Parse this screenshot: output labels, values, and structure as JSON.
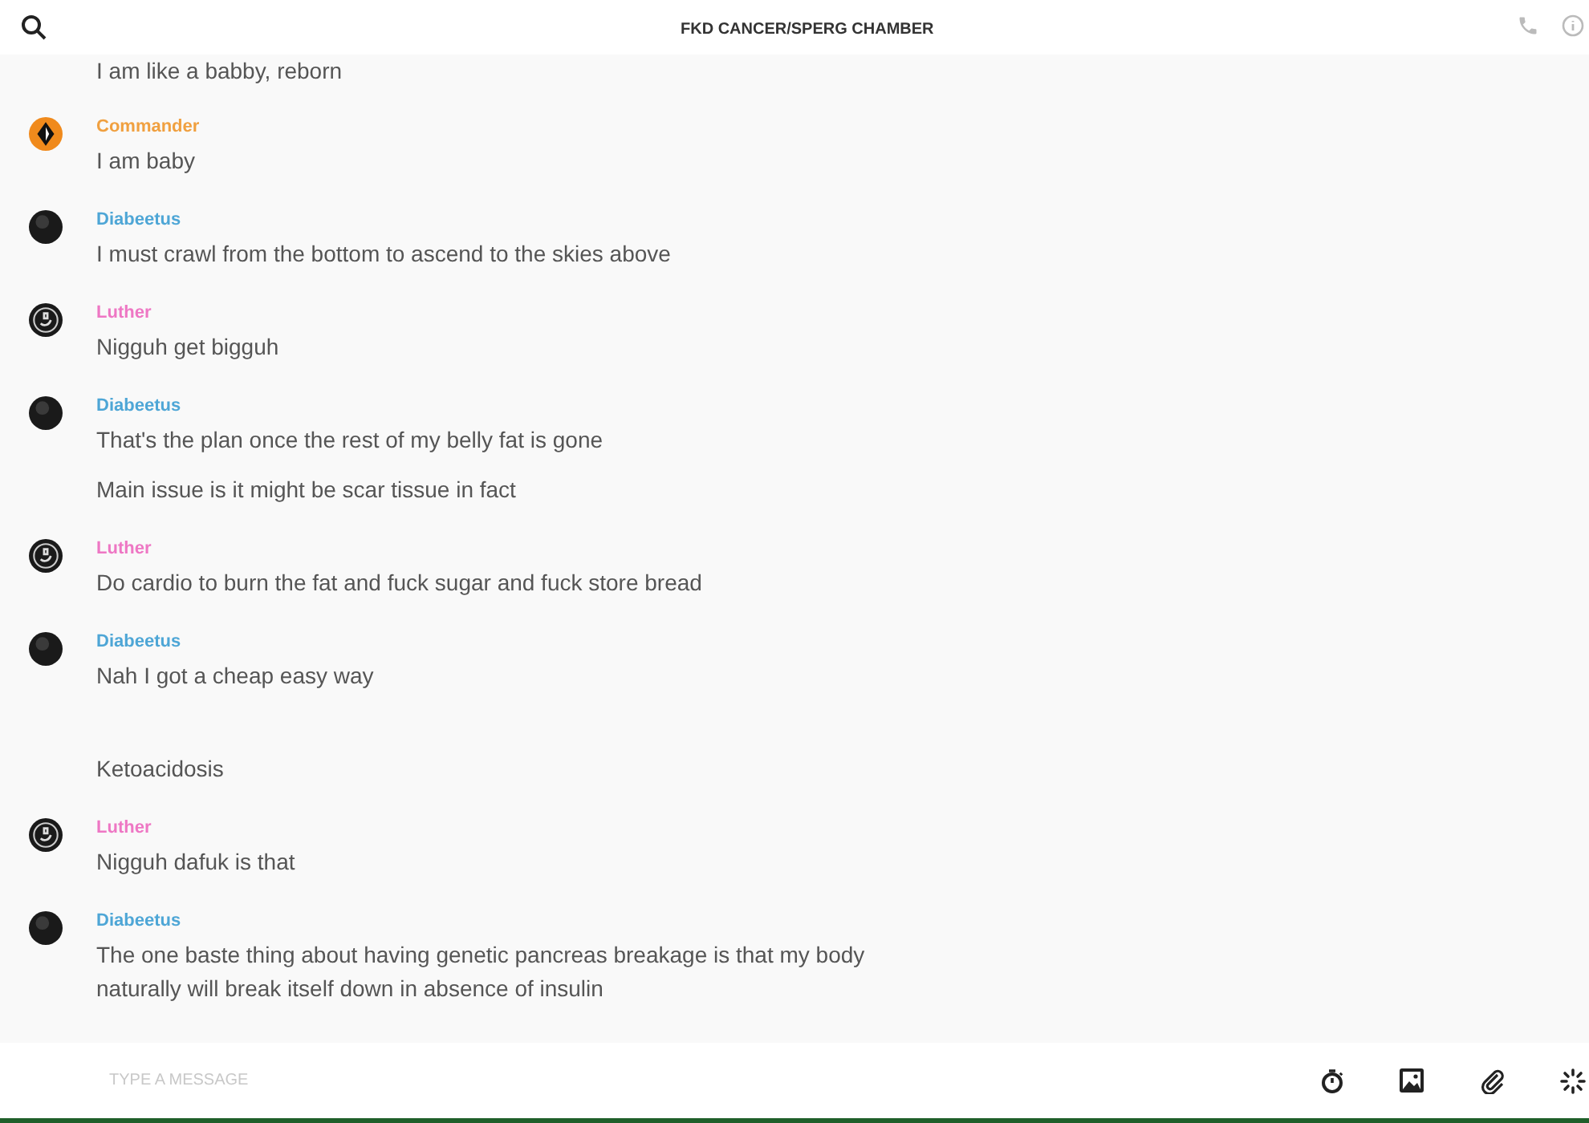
{
  "header": {
    "title": "FKD CANCER/SPERG CHAMBER"
  },
  "partial_message": "I am like a babby, reborn",
  "groups": [
    {
      "author": "Commander",
      "color": "#f0a040",
      "kind": "diamond",
      "messages": [
        "I am baby"
      ]
    },
    {
      "author": "Diabeetus",
      "color": "#4ea6d6",
      "kind": "dark",
      "messages": [
        "I must crawl from the bottom to ascend to the skies above"
      ]
    },
    {
      "author": "Luther",
      "color": "#ee77c4",
      "kind": "emblem",
      "messages": [
        "Nigguh get bigguh"
      ]
    },
    {
      "author": "Diabeetus",
      "color": "#4ea6d6",
      "kind": "dark",
      "messages": [
        "That's the plan once the rest of my belly fat is gone",
        "Main issue is it might be scar tissue in fact"
      ]
    },
    {
      "author": "Luther",
      "color": "#ee77c4",
      "kind": "emblem",
      "messages": [
        "Do cardio to burn the fat and fuck sugar and fuck store bread"
      ]
    },
    {
      "author": "Diabeetus",
      "color": "#4ea6d6",
      "kind": "dark",
      "messages": [
        "Nah I got a cheap easy way"
      ]
    },
    {
      "messages": [
        "Ketoacidosis"
      ]
    },
    {
      "author": "Luther",
      "color": "#ee77c4",
      "kind": "emblem",
      "messages": [
        "Nigguh dafuk is that"
      ]
    },
    {
      "author": "Diabeetus",
      "color": "#4ea6d6",
      "kind": "dark",
      "messages": [
        "The one baste thing about having genetic pancreas breakage is that my body naturally will break itself down in absence of insulin"
      ]
    }
  ],
  "composer": {
    "placeholder": "TYPE A MESSAGE"
  }
}
